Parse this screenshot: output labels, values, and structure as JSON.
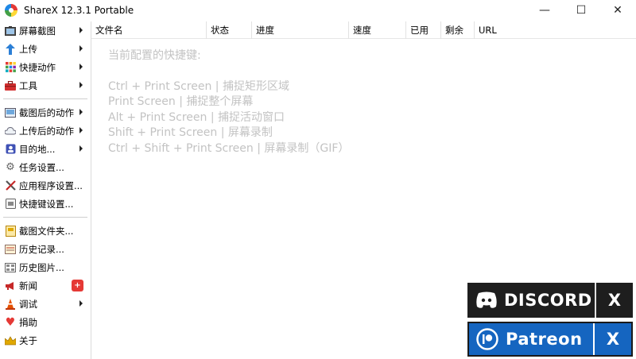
{
  "window": {
    "title": "ShareX 12.3.1 Portable",
    "controls": {
      "minimize": "—",
      "maximize": "☐",
      "close": "✕"
    }
  },
  "sidebar": {
    "items": [
      {
        "label": "屏幕截图",
        "icon": "capture-icon",
        "submenu": true
      },
      {
        "label": "上传",
        "icon": "upload-arrow-icon",
        "submenu": true
      },
      {
        "label": "快捷动作",
        "icon": "quick-actions-grid-icon",
        "submenu": true
      },
      {
        "label": "工具",
        "icon": "toolbox-icon",
        "submenu": true
      },
      {
        "label": "截图后的动作",
        "icon": "after-capture-icon",
        "submenu": true
      },
      {
        "label": "上传后的动作",
        "icon": "after-upload-cloud-icon",
        "submenu": true
      },
      {
        "label": "目的地...",
        "icon": "destinations-icon",
        "submenu": true
      },
      {
        "label": "任务设置...",
        "icon": "gear-icon",
        "submenu": false
      },
      {
        "label": "应用程序设置...",
        "icon": "tools-wrench-icon",
        "submenu": false
      },
      {
        "label": "快捷键设置...",
        "icon": "keyboard-icon",
        "submenu": false
      },
      {
        "label": "截图文件夹...",
        "icon": "folder-icon",
        "submenu": false
      },
      {
        "label": "历史记录...",
        "icon": "history-icon",
        "submenu": false
      },
      {
        "label": "历史图片...",
        "icon": "image-history-icon",
        "submenu": false
      },
      {
        "label": "新闻",
        "icon": "megaphone-icon",
        "submenu": false,
        "badge": "+"
      },
      {
        "label": "调试",
        "icon": "traffic-cone-icon",
        "submenu": true
      },
      {
        "label": "捐助",
        "icon": "heart-icon",
        "submenu": false
      },
      {
        "label": "关于",
        "icon": "crown-icon",
        "submenu": false
      }
    ]
  },
  "list": {
    "columns": [
      "文件名",
      "状态",
      "进度",
      "速度",
      "已用",
      "剩余",
      "URL"
    ]
  },
  "hotkeys": {
    "title": "当前配置的快捷键:",
    "lines": [
      "Ctrl + Print Screen  |  捕捉矩形区域",
      "Print Screen  |  捕捉整个屏幕",
      "Alt + Print Screen  |  捕捉活动窗口",
      "Shift + Print Screen  |  屏幕录制",
      "Ctrl + Shift + Print Screen  |  屏幕录制（GIF）"
    ]
  },
  "promos": {
    "discord": {
      "label": "DISCORD",
      "close": "X",
      "color": "#1e1e1e"
    },
    "patreon": {
      "label": "Patreon",
      "close": "X",
      "color": "#1565c0"
    }
  }
}
